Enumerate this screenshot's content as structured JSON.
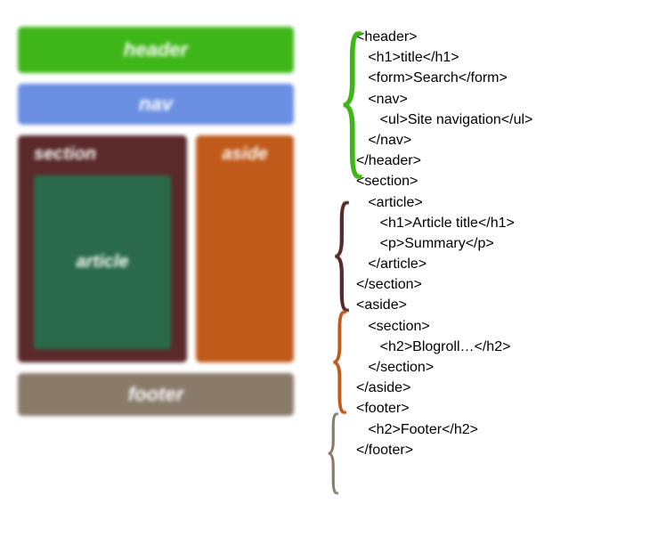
{
  "diagram": {
    "header": "header",
    "nav": "nav",
    "section": "section",
    "article": "article",
    "aside": "aside",
    "footer": "footer"
  },
  "code": {
    "header": [
      "<header>",
      "   <h1>title</h1>",
      "   <form>Search</form>",
      "   <nav>",
      "      <ul>Site navigation</ul>",
      "   </nav>",
      "</header>"
    ],
    "section": [
      "<section>",
      "   <article>",
      "      <h1>Article title</h1>",
      "      <p>Summary</p>",
      "   </article>",
      "</section>"
    ],
    "aside": [
      "<aside>",
      "   <section>",
      "      <h2>Blogroll…</h2>",
      "   </section>",
      "</aside>"
    ],
    "footer": [
      "<footer>",
      "   <h2>Footer</h2>",
      "</footer>"
    ]
  }
}
